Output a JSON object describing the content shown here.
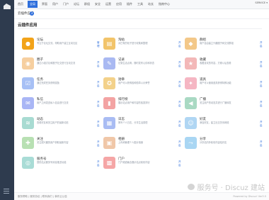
{
  "nav": [
    "首页",
    "全局",
    "界面",
    "用户",
    "门户",
    "论坛",
    "群组",
    "安全",
    "运营",
    "应用",
    "插件",
    "工具",
    "站长",
    "指南中心"
  ],
  "user": "SERVICE ▾",
  "subheader": {
    "title": "云插件应用",
    "badge": "3"
  },
  "section_title": "云插件应用",
  "apps": [
    {
      "name": "论坛",
      "desc": "专注于论坛交流，帮助用户建立互动社区",
      "op": "管理",
      "color": "#f2a31a",
      "icon": "chat-icon"
    },
    {
      "name": "淘帖",
      "desc": "对已有的帖子进行收集和整理",
      "op": "开启",
      "color": "#f2c46a",
      "icon": "collection-icon"
    },
    {
      "name": "群组",
      "desc": "用户自由建立兴趣圈子和交流群组",
      "op": "开启",
      "color": "#f3c889",
      "icon": "group-icon"
    },
    {
      "name": "圈子",
      "desc": "通过小组讨论和圈子社交进行互动交流",
      "op": "开启",
      "color": "#f6cfa0",
      "icon": "circle-icon"
    },
    {
      "name": "记录",
      "desc": "记录生活点滴，随时发布心情和状态",
      "op": "开启",
      "color": "#a9b9f2",
      "icon": "record-icon"
    },
    {
      "name": "收藏",
      "desc": "收藏喜欢的内容，方便以后查看",
      "op": "开启",
      "color": "#f3b8b8",
      "icon": "favorite-icon"
    },
    {
      "name": "任务",
      "desc": "通过完成任务获得奖励",
      "op": "开启",
      "color": "#a7c0f5",
      "icon": "task-icon"
    },
    {
      "name": "勋章",
      "desc": "用户可以获得各种勋章以示荣誉",
      "op": "开启",
      "color": "#f3d18a",
      "icon": "medal-icon"
    },
    {
      "name": "道具",
      "desc": "用户可以使用道具获得特殊功能",
      "op": "开启",
      "color": "#f5b6c3",
      "icon": "magic-icon"
    },
    {
      "name": "私信",
      "desc": "用户之间发送私人信息进行交流",
      "op": "开启",
      "color": "#a9b6f5",
      "icon": "message-icon"
    },
    {
      "name": "排行榜",
      "desc": "展示站点用户和内容的各类排行",
      "op": "开启",
      "color": "#f3a3a3",
      "icon": "ranking-icon"
    },
    {
      "name": "广播",
      "desc": "关注用户的动态并进行广播转发",
      "op": "开启",
      "color": "#a9d9c3",
      "icon": "broadcast-icon"
    },
    {
      "name": "动态",
      "desc": "查看好友和关注用户的最新动态",
      "op": "开启",
      "color": "#a8dbd2",
      "icon": "feed-icon"
    },
    {
      "name": "日志",
      "desc": "撰写个人日志，分享生活感悟",
      "op": "开启",
      "color": "#a9bcf3",
      "icon": "blog-icon"
    },
    {
      "name": "好友",
      "desc": "添加好友，建立社交关系网络",
      "op": "开启",
      "color": "#b0d6f3",
      "icon": "friend-icon"
    },
    {
      "name": "关注",
      "desc": "关注感兴趣的用户获取最新内容",
      "op": "开启",
      "color": "#b8e0b3",
      "icon": "follow-icon"
    },
    {
      "name": "相册",
      "desc": "上传和管理个人图片相册",
      "op": "开启",
      "color": "#f0c7a8",
      "icon": "album-icon"
    },
    {
      "name": "分享",
      "desc": "分享站内外精彩内容给好友",
      "op": "开启",
      "color": "#a9d6f3",
      "icon": "share-icon"
    },
    {
      "name": "服务号",
      "desc": "提供站点服务号消息推送功能",
      "op": "开启",
      "color": "#a9dcd6",
      "icon": "service-icon"
    },
    {
      "name": "门户",
      "desc": "门户频道聚合展示站点精彩内容",
      "op": "开启",
      "color": "#f5a6a6",
      "icon": "portal-icon"
    }
  ],
  "footer": {
    "links": "服务帮助 | 服务协议 | 联系我们 | 事件云公告",
    "powered": "Powered by Discuz! Ver3.5"
  },
  "watermark": "服务号 · Discuz 建站"
}
